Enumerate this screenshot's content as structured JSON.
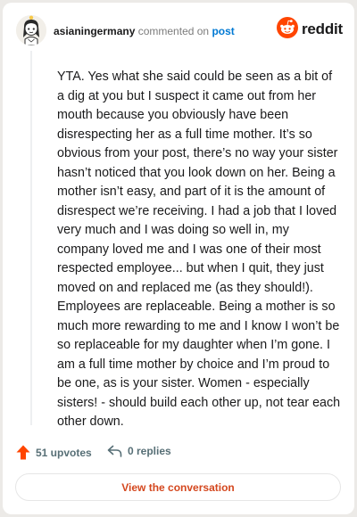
{
  "comment": {
    "username": "asianingermany",
    "action_text": "commented on",
    "target_text": "post",
    "body": "YTA. Yes what she said could be seen as a bit of a dig at you but I suspect it came out from her mouth because you obviously have been disrespecting her as a full time mother. It’s so obvious from your post, there’s no way your sister hasn’t noticed that you look down on her. Being a mother isn’t easy, and part of it is the amount of disrespect we’re receiving. I had a job that I loved very much and I was doing so well in, my company loved me and I was one of their most respected employee... but when I quit, they just moved on and replaced me (as they should!). Employees are replaceable. Being a mother is so much more rewarding to me and I know I won’t be so replaceable for my daughter when I’m gone. I am a full time mother by choice and I’m proud to be one, as is your sister. Women - especially sisters! - should build each other up, not tear each other down."
  },
  "brand": {
    "name": "reddit",
    "color": "#ff4500"
  },
  "footer": {
    "upvotes_label": "51 upvotes",
    "replies_label": "0 replies"
  },
  "cta": {
    "label": "View the conversation",
    "color": "#d4471e"
  },
  "icons": {
    "avatar": "snoo-avatar-icon",
    "logo": "reddit-snoo-icon",
    "upvote": "upvote-arrow-icon",
    "reply": "reply-arrow-icon"
  }
}
